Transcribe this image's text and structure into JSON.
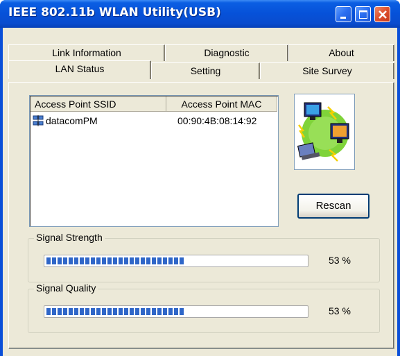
{
  "window": {
    "title": "IEEE 802.11b WLAN Utility(USB)"
  },
  "tabs_back": [
    {
      "label": "Link Information"
    },
    {
      "label": "Diagnostic"
    },
    {
      "label": "About"
    }
  ],
  "tabs_front": [
    {
      "label": "LAN Status"
    },
    {
      "label": "Setting"
    },
    {
      "label": "Site Survey"
    }
  ],
  "active_tab": "LAN Status",
  "list": {
    "columns": [
      "Access Point SSID",
      "Access Point MAC"
    ],
    "rows": [
      {
        "ssid": "datacomPM",
        "mac": "00:90:4B:08:14:92"
      }
    ]
  },
  "rescan_label": "Rescan",
  "signal_strength": {
    "label": "Signal Strength",
    "value": 53,
    "display": "53 %"
  },
  "signal_quality": {
    "label": "Signal Quality",
    "value": 53,
    "display": "53 %"
  },
  "colors": {
    "titlebar": "#0651d8",
    "face": "#ece9d8",
    "progress": "#2f66c8"
  }
}
